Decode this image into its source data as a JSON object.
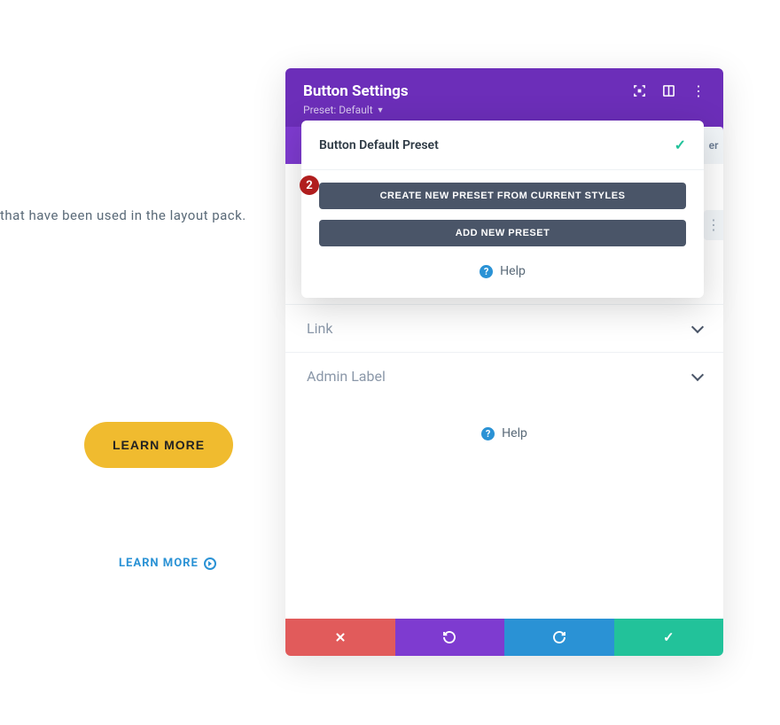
{
  "background": {
    "text_fragment": "that have been used in the layout pack.",
    "learn_more_button": "LEARN MORE",
    "learn_more_link": "LEARN MORE"
  },
  "modal": {
    "title": "Button Settings",
    "preset_label": "Preset: Default",
    "tab_peek": "er",
    "accordion": {
      "link": "Link",
      "admin_label": "Admin Label"
    },
    "help": "Help"
  },
  "dropdown": {
    "default_preset": "Button Default Preset",
    "create_from_styles": "CREATE NEW PRESET FROM CURRENT STYLES",
    "add_new": "ADD NEW PRESET",
    "help": "Help",
    "step_badge": "2"
  },
  "footer": {
    "cancel": "cancel",
    "undo": "undo",
    "redo": "redo",
    "save": "save"
  },
  "colors": {
    "purple": "#6c2eb9",
    "purple_light": "#7e3bd0",
    "red": "#e15b5b",
    "blue": "#2a92d5",
    "green": "#22c29a",
    "yellow": "#f0bb2f",
    "dark_btn": "#4a5568"
  }
}
